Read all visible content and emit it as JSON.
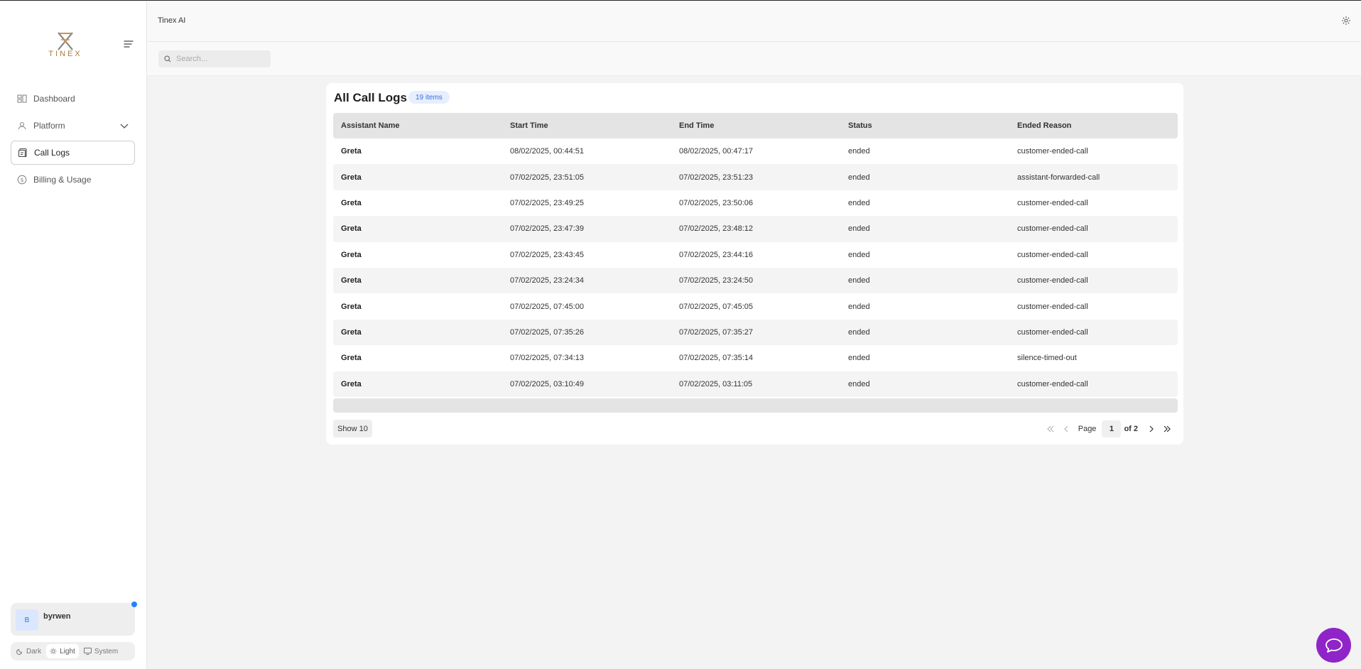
{
  "app": {
    "title": "Tinex AI",
    "logo_text": "TINEX"
  },
  "search": {
    "placeholder": "Search..."
  },
  "sidebar": {
    "items": [
      {
        "label": "Dashboard",
        "icon": "dashboard-icon"
      },
      {
        "label": "Platform",
        "icon": "platform-icon"
      },
      {
        "label": "Call Logs",
        "icon": "call-logs-icon",
        "active": true
      },
      {
        "label": "Billing & Usage",
        "icon": "billing-icon"
      }
    ]
  },
  "user": {
    "initial": "B",
    "name": "byrwen"
  },
  "theme": {
    "dark": "Dark",
    "light": "Light",
    "system": "System",
    "selected": "Light"
  },
  "main": {
    "title": "All Call Logs",
    "count": "19 items",
    "columns": [
      "Assistant Name",
      "Start Time",
      "End Time",
      "Status",
      "Ended Reason"
    ],
    "rows": [
      [
        "Greta",
        "08/02/2025, 00:44:51",
        "08/02/2025, 00:47:17",
        "ended",
        "customer-ended-call"
      ],
      [
        "Greta",
        "07/02/2025, 23:51:05",
        "07/02/2025, 23:51:23",
        "ended",
        "assistant-forwarded-call"
      ],
      [
        "Greta",
        "07/02/2025, 23:49:25",
        "07/02/2025, 23:50:06",
        "ended",
        "customer-ended-call"
      ],
      [
        "Greta",
        "07/02/2025, 23:47:39",
        "07/02/2025, 23:48:12",
        "ended",
        "customer-ended-call"
      ],
      [
        "Greta",
        "07/02/2025, 23:43:45",
        "07/02/2025, 23:44:16",
        "ended",
        "customer-ended-call"
      ],
      [
        "Greta",
        "07/02/2025, 23:24:34",
        "07/02/2025, 23:24:50",
        "ended",
        "customer-ended-call"
      ],
      [
        "Greta",
        "07/02/2025, 07:45:00",
        "07/02/2025, 07:45:05",
        "ended",
        "customer-ended-call"
      ],
      [
        "Greta",
        "07/02/2025, 07:35:26",
        "07/02/2025, 07:35:27",
        "ended",
        "customer-ended-call"
      ],
      [
        "Greta",
        "07/02/2025, 07:34:13",
        "07/02/2025, 07:35:14",
        "ended",
        "silence-timed-out"
      ],
      [
        "Greta",
        "07/02/2025, 03:10:49",
        "07/02/2025, 03:11:05",
        "ended",
        "customer-ended-call"
      ]
    ]
  },
  "pagination": {
    "show": "Show 10",
    "page_label": "Page",
    "current": "1",
    "of": "of 2"
  },
  "colors": {
    "accent": "#3a6ed8",
    "chat_fab": "#8f25c9",
    "notification": "#2680ff"
  }
}
